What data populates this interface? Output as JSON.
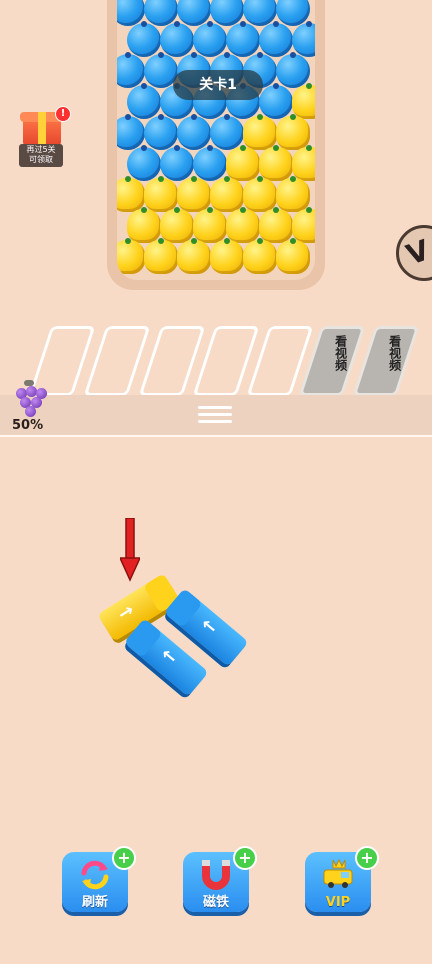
{
  "level": {
    "label": "关卡1"
  },
  "gift": {
    "badge": "!",
    "text_line1": "再过5关",
    "text_line2": "可领取"
  },
  "slots": {
    "locked_label": "看视频"
  },
  "progress": {
    "fruit_icon": "grape-icon",
    "percent": "50%"
  },
  "buttons": [
    {
      "label": "刷新",
      "icon": "refresh-icon"
    },
    {
      "label": "磁铁",
      "icon": "magnet-icon"
    },
    {
      "label": "VIP",
      "icon": "vip-truck-icon"
    }
  ],
  "colors": {
    "background": "#f7dbc6",
    "blue": "#1e8fe6",
    "yellow": "#ffd21b",
    "button_blue": "#2a8ef0",
    "plus_green": "#47cf4a",
    "arrow_red": "#e22222"
  }
}
